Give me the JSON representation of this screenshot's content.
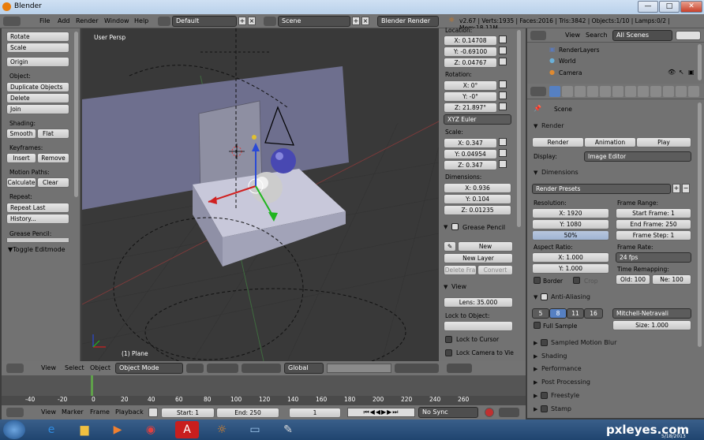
{
  "window": {
    "title": "Blender",
    "min": "—",
    "max": "□",
    "close": "✕"
  },
  "menubar": {
    "items": [
      "File",
      "Add",
      "Render",
      "Window",
      "Help"
    ],
    "layout": "Default",
    "scene": "Scene",
    "engine": "Blender Render",
    "stats": "v2.67 | Verts:1935 | Faces:2016 | Tris:3842 | Objects:1/10 | Lamps:0/2 | Mem:18.11M"
  },
  "toolshelf": {
    "transform_buttons": [
      "Rotate",
      "Scale"
    ],
    "origin": "Origin",
    "object_label": "Object:",
    "object_buttons": [
      "Duplicate Objects",
      "Delete",
      "Join"
    ],
    "shading_label": "Shading:",
    "smooth": "Smooth",
    "flat": "Flat",
    "keyframes_label": "Keyframes:",
    "insert": "Insert",
    "remove": "Remove",
    "motion_label": "Motion Paths:",
    "calculate": "Calculate",
    "clear": "Clear",
    "repeat_label": "Repeat:",
    "repeat_last": "Repeat Last",
    "history": "History...",
    "grease_label": "Grease Pencil:",
    "toggle_editmode": "▼Toggle Editmode"
  },
  "viewport": {
    "view_label": "User Persp",
    "object_label": "(1) Plane"
  },
  "npanel": {
    "location_label": "Location:",
    "loc": [
      "X: 0.14708",
      "Y: -0.69100",
      "Z: 0.04767"
    ],
    "rotation_label": "Rotation:",
    "rot": [
      "X: 0°",
      "Y: -0°",
      "Z: 21.897°"
    ],
    "euler": "XYZ Euler",
    "scale_label": "Scale:",
    "scale": [
      "X: 0.347",
      "Y: 0.04954",
      "Z: 0.347"
    ],
    "dimensions_label": "Dimensions:",
    "dims": [
      "X: 0.936",
      "Y: 0.104",
      "Z: 0.01235"
    ],
    "grease_pencil": "Grease Pencil",
    "new": "New",
    "new_layer": "New Layer",
    "delete_frame": "Delete Fra",
    "convert": "Convert",
    "view_hdr": "View",
    "lens": "Lens: 35.000",
    "lock_to_object": "Lock to Object:",
    "lock_to_cursor": "Lock to Cursor",
    "lock_camera": "Lock Camera to Vie"
  },
  "outliner": {
    "view": "View",
    "search": "Search",
    "all_scenes": "All Scenes",
    "items": [
      "RenderLayers",
      "World",
      "Camera"
    ]
  },
  "props": {
    "scene": "Scene",
    "render_hdr": "Render",
    "render_btn": "Render",
    "animation_btn": "Animation",
    "play_btn": "Play",
    "display_label": "Display:",
    "display_value": "Image Editor",
    "dimensions_hdr": "Dimensions",
    "render_presets": "Render Presets",
    "resolution_label": "Resolution:",
    "res_x": "X: 1920",
    "res_y": "Y: 1080",
    "res_pct": "50%",
    "frame_range_label": "Frame Range:",
    "start_frame": "Start Frame: 1",
    "end_frame": "End Frame: 250",
    "frame_step": "Frame Step: 1",
    "aspect_label": "Aspect Ratio:",
    "aspect_x": "X: 1.000",
    "aspect_y": "Y: 1.000",
    "frame_rate_label": "Frame Rate:",
    "fps": "24 fps",
    "time_remap_label": "Time Remapping:",
    "old": "Old: 100",
    "ne": "Ne: 100",
    "border": "Border",
    "crop": "Crop",
    "aa_hdr": "Anti-Aliasing",
    "aa_samples": [
      "5",
      "8",
      "11",
      "16"
    ],
    "aa_filter": "Mitchell-Netravali",
    "full_sample": "Full Sample",
    "size": "Size: 1.000",
    "collapsed": [
      "Sampled Motion Blur",
      "Shading",
      "Performance",
      "Post Processing",
      "Freestyle",
      "Stamp"
    ]
  },
  "vpheader": {
    "view": "View",
    "select": "Select",
    "object": "Object",
    "mode": "Object Mode",
    "orientation": "Global"
  },
  "timeline": {
    "ticks": [
      "-40",
      "-20",
      "0",
      "20",
      "40",
      "60",
      "80",
      "100",
      "120",
      "140",
      "160",
      "180",
      "200",
      "220",
      "240",
      "260"
    ]
  },
  "tlheader": {
    "view": "View",
    "marker": "Marker",
    "frame": "Frame",
    "playback": "Playback",
    "start": "Start: 1",
    "end": "End: 250",
    "current": "1",
    "sync": "No Sync"
  },
  "taskbar": {
    "date": "5/18/2013",
    "watermark": "pxleyes.com"
  }
}
